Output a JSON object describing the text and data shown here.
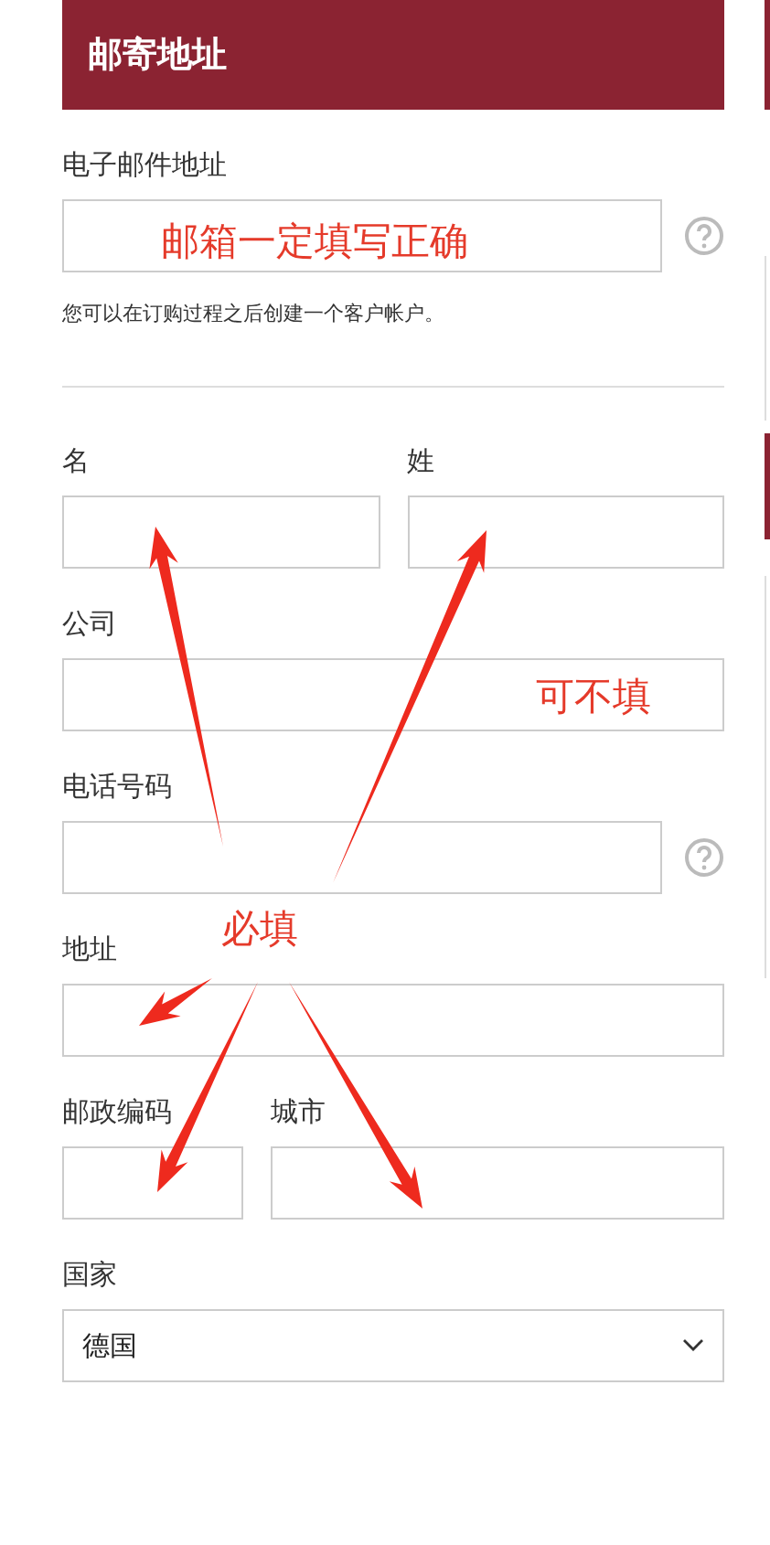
{
  "header": {
    "title": "邮寄地址"
  },
  "email": {
    "label": "电子邮件地址",
    "help": true,
    "hint": "您可以在订购过程之后创建一个客户帐户。"
  },
  "rows": [
    {
      "fields": [
        {
          "label": "名",
          "kind": "full",
          "help": false
        },
        {
          "label": "姓",
          "kind": "full",
          "help": false
        }
      ]
    },
    {
      "fields": [
        {
          "label": "公司",
          "kind": "full",
          "help": false
        }
      ]
    },
    {
      "fields": [
        {
          "label": "电话号码",
          "kind": "full",
          "help": true
        }
      ]
    },
    {
      "fields": [
        {
          "label": "地址",
          "kind": "full",
          "help": false
        }
      ]
    },
    {
      "fields": [
        {
          "label": "邮政编码",
          "kind": "short",
          "help": false
        },
        {
          "label": "城市",
          "kind": "full",
          "help": false
        }
      ]
    }
  ],
  "country": {
    "label": "国家",
    "value": "德国"
  },
  "annotations": [
    {
      "text": "邮箱一定填写正确"
    },
    {
      "text": "可不填"
    },
    {
      "text": "必填"
    }
  ]
}
